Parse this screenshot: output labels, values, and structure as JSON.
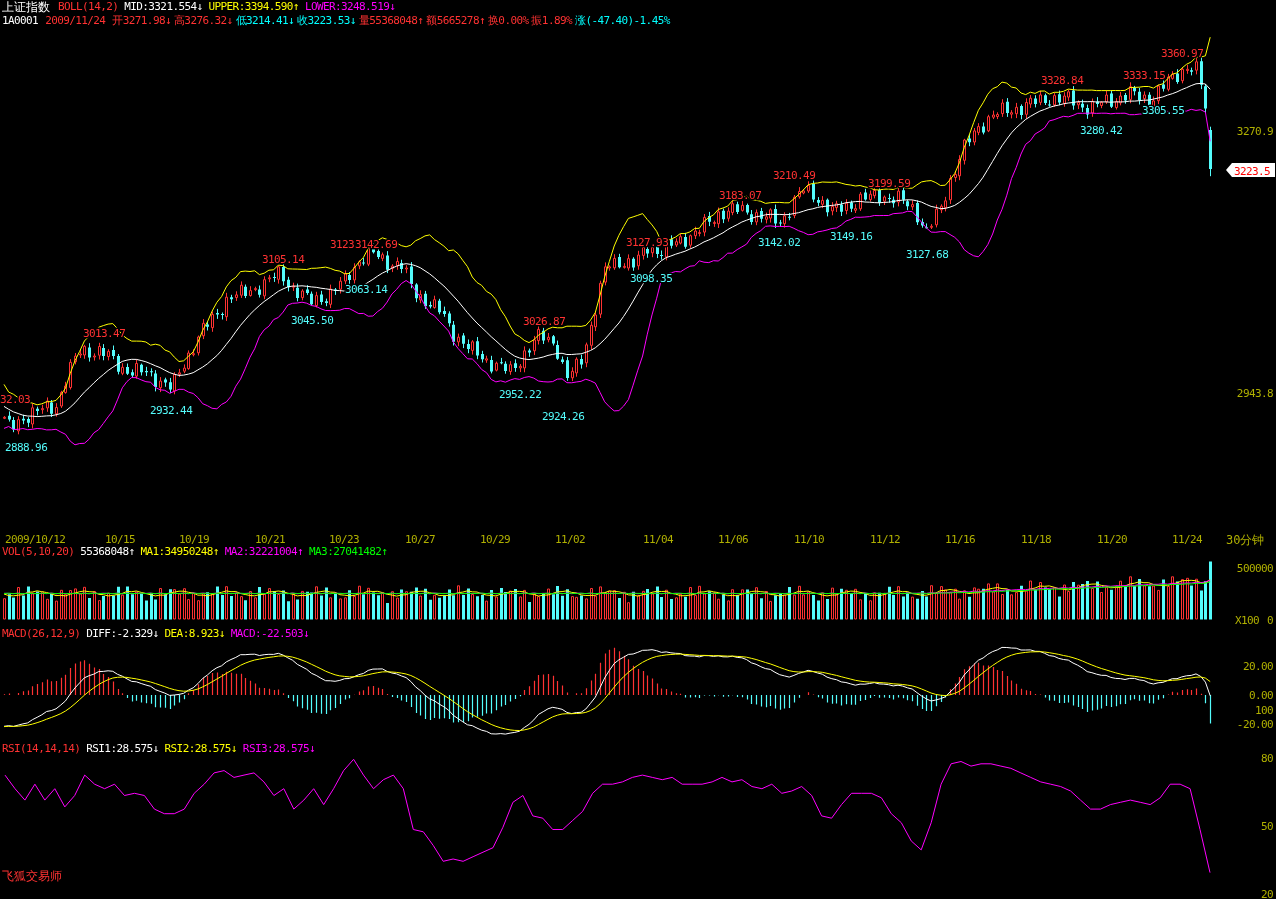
{
  "header": {
    "title": "上证指数",
    "indicator": "BOLL(14,2)",
    "items": [
      {
        "text": "MID:3321.554↓",
        "color": "#ffffff"
      },
      {
        "text": "UPPER:3394.590↑",
        "color": "#ffff00"
      },
      {
        "text": "LOWER:3248.519↓",
        "color": "#ff00ff"
      }
    ]
  },
  "quote": {
    "code": "1A0001",
    "date": "2009/11/24",
    "fields": [
      {
        "text": "开3271.98↓",
        "color": "#ff3232"
      },
      {
        "text": "高3276.32↓",
        "color": "#ff3232"
      },
      {
        "text": "低3214.41↓",
        "color": "#00ffff"
      },
      {
        "text": "收3223.53↓",
        "color": "#00ffff"
      },
      {
        "text": "量55368048↑",
        "color": "#ff3232"
      },
      {
        "text": "额5665278↑",
        "color": "#ff3232"
      },
      {
        "text": "换0.00%",
        "color": "#ff3232"
      },
      {
        "text": "振1.89%",
        "color": "#ff3232"
      },
      {
        "text": "涨(-47.40)-1.45%",
        "color": "#00ffff"
      }
    ]
  },
  "price_chart": {
    "y_ticks": [
      "3270.9",
      "2943.8"
    ],
    "current_price": "3223.5",
    "annotations": [
      {
        "text": "32.03",
        "kind": "high"
      },
      {
        "text": "2888.96",
        "kind": "low"
      },
      {
        "text": "3013.47",
        "kind": "high"
      },
      {
        "text": "2932.44",
        "kind": "low"
      },
      {
        "text": "3105.14",
        "kind": "high"
      },
      {
        "text": "3123",
        "kind": "high"
      },
      {
        "text": "3142.69",
        "kind": "high"
      },
      {
        "text": "3045.50",
        "kind": "low"
      },
      {
        "text": "3063.14",
        "kind": "low"
      },
      {
        "text": "3026.87",
        "kind": "high"
      },
      {
        "text": "2952.22",
        "kind": "low"
      },
      {
        "text": "2924.26",
        "kind": "low"
      },
      {
        "text": "3127.93",
        "kind": "high"
      },
      {
        "text": "3098.35",
        "kind": "low"
      },
      {
        "text": "3183.07",
        "kind": "high"
      },
      {
        "text": "3210.49",
        "kind": "high"
      },
      {
        "text": "3142.02",
        "kind": "low"
      },
      {
        "text": "3199.59",
        "kind": "high"
      },
      {
        "text": "3149.16",
        "kind": "low"
      },
      {
        "text": "3127.68",
        "kind": "low"
      },
      {
        "text": "3328.84",
        "kind": "high"
      },
      {
        "text": "3280.42",
        "kind": "low"
      },
      {
        "text": "3360.97",
        "kind": "high"
      },
      {
        "text": "3333.15",
        "kind": "high"
      },
      {
        "text": "3305.55",
        "kind": "low"
      }
    ]
  },
  "date_axis": {
    "labels": [
      "2009/10/12",
      "10/15",
      "10/19",
      "10/21",
      "10/23",
      "10/27",
      "10/29",
      "11/02",
      "11/04",
      "11/06",
      "11/10",
      "11/12",
      "11/16",
      "11/18",
      "11/20",
      "11/24"
    ],
    "period": "30分钟"
  },
  "volume_panel": {
    "indicator": "VOL(5,10,20)",
    "items": [
      {
        "text": "55368048↑",
        "color": "#ffffff"
      },
      {
        "text": "MA1:34950248↑",
        "color": "#ffff00"
      },
      {
        "text": "MA2:32221004↑",
        "color": "#ff00ff"
      },
      {
        "text": "MA3:27041482↑",
        "color": "#00ff00"
      }
    ],
    "y_ticks": [
      "500000",
      "0"
    ],
    "unit": "X100"
  },
  "macd_panel": {
    "indicator": "MACD(26,12,9)",
    "items": [
      {
        "text": "DIFF:-2.329↓",
        "color": "#ffffff"
      },
      {
        "text": "DEA:8.923↓",
        "color": "#ffff00"
      },
      {
        "text": "MACD:-22.503↓",
        "color": "#ff00ff"
      }
    ],
    "y_ticks": [
      "20.00",
      "0.00",
      "100",
      "-20.00"
    ]
  },
  "rsi_panel": {
    "indicator": "RSI(14,14,14)",
    "items": [
      {
        "text": "RSI1:28.575↓",
        "color": "#ffffff"
      },
      {
        "text": "RSI2:28.575↓",
        "color": "#ffff00"
      },
      {
        "text": "RSI3:28.575↓",
        "color": "#ff00ff"
      }
    ],
    "chart_data": {
      "type": "line",
      "ylim": [
        20,
        80
      ],
      "yticks": [
        80,
        50,
        20
      ],
      "series": [
        {
          "color": "#ff00ff",
          "values": [
            72,
            66,
            61,
            68,
            61,
            66,
            58,
            63,
            72,
            68,
            66,
            68,
            63,
            64,
            63,
            57,
            55,
            55,
            57,
            64,
            68,
            73,
            74,
            71,
            72,
            73,
            69,
            63,
            66,
            57,
            61,
            66,
            59,
            66,
            74,
            79,
            72,
            66,
            70,
            72,
            66,
            48,
            47,
            41,
            34,
            35,
            34,
            36,
            38,
            40,
            49,
            60,
            63,
            54,
            53,
            48,
            48,
            52,
            56,
            64,
            68,
            68,
            69,
            71,
            72,
            71,
            70,
            71,
            68,
            68,
            68,
            69,
            71,
            69,
            70,
            67,
            66,
            68,
            64,
            65,
            67,
            63,
            54,
            53,
            59,
            64,
            64,
            64,
            62,
            55,
            51,
            43,
            39,
            51,
            68,
            77,
            78,
            76,
            77,
            77,
            76,
            75,
            73,
            71,
            69,
            68,
            67,
            65,
            61,
            57,
            57,
            59,
            60,
            61,
            60,
            59,
            62,
            68,
            68,
            66,
            48,
            29
          ]
        }
      ]
    }
  },
  "brand": "飞狐交易师"
}
